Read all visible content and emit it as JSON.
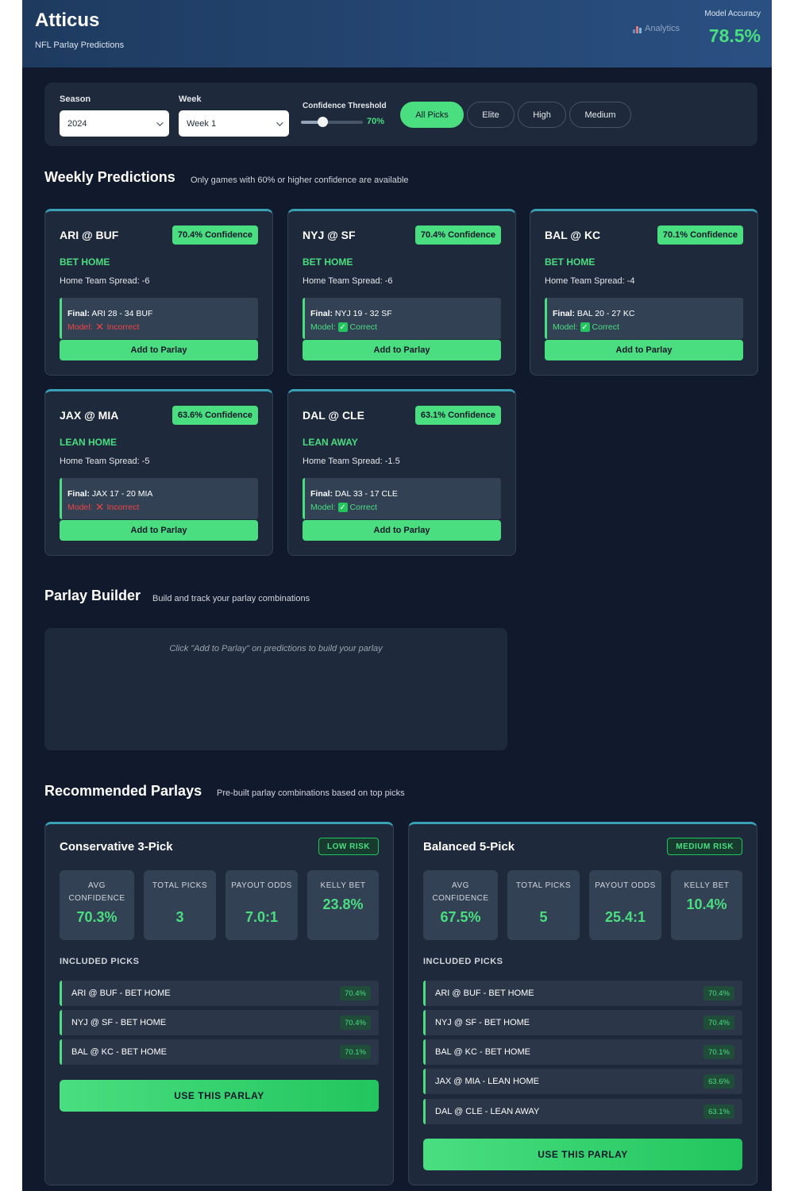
{
  "header": {
    "title": "Atticus",
    "subtitle": "NFL Parlay Predictions",
    "analytics_link": "Analytics",
    "analytics_icon": "bar-chart-icon",
    "accuracy_label": "Model Accuracy",
    "accuracy_value": "78.5%"
  },
  "filters": {
    "season_label": "Season",
    "season_value": "2024",
    "week_label": "Week",
    "week_value": "Week 1",
    "threshold_label": "Confidence Threshold",
    "threshold_value": "70%",
    "threshold_fraction": 0.35,
    "tabs": [
      "All Picks",
      "Elite",
      "High",
      "Medium"
    ],
    "active_tab": "All Picks"
  },
  "weekly": {
    "title": "Weekly Predictions",
    "subtitle": "Only games with 60% or higher confidence are available",
    "add_label": "Add to Parlay",
    "final_label": "Final:",
    "model_label": "Model:",
    "cards": [
      {
        "matchup": "ARI @ BUF",
        "confidence": "70.4% Confidence",
        "bet": "BET HOME",
        "spread": "Home Team Spread: -6",
        "final": "ARI 28 - 34 BUF",
        "model_result": "Incorrect",
        "correct": false
      },
      {
        "matchup": "NYJ @ SF",
        "confidence": "70.4% Confidence",
        "bet": "BET HOME",
        "spread": "Home Team Spread: -6",
        "final": "NYJ 19 - 32 SF",
        "model_result": "Correct",
        "correct": true
      },
      {
        "matchup": "BAL @ KC",
        "confidence": "70.1% Confidence",
        "bet": "BET HOME",
        "spread": "Home Team Spread: -4",
        "final": "BAL 20 - 27 KC",
        "model_result": "Correct",
        "correct": true
      },
      {
        "matchup": "JAX @ MIA",
        "confidence": "63.6% Confidence",
        "bet": "LEAN HOME",
        "spread": "Home Team Spread: -5",
        "final": "JAX 17 - 20 MIA",
        "model_result": "Incorrect",
        "correct": false
      },
      {
        "matchup": "DAL @ CLE",
        "confidence": "63.1% Confidence",
        "bet": "LEAN AWAY",
        "spread": "Home Team Spread: -1.5",
        "final": "DAL 33 - 17 CLE",
        "model_result": "Correct",
        "correct": true
      }
    ]
  },
  "builder": {
    "title": "Parlay Builder",
    "subtitle": "Build and track your parlay combinations",
    "empty_text": "Click \"Add to Parlay\" on predictions to build your parlay"
  },
  "recommended": {
    "title": "Recommended Parlays",
    "subtitle": "Pre-built parlay combinations based on top picks",
    "stat_labels": [
      "AVG CONFIDENCE",
      "TOTAL PICKS",
      "PAYOUT ODDS",
      "KELLY BET"
    ],
    "included_label": "INCLUDED PICKS",
    "use_label": "USE THIS PARLAY",
    "parlays": [
      {
        "title": "Conservative 3-Pick",
        "risk": "LOW RISK",
        "stats": [
          "70.3%",
          "3",
          "7.0:1",
          "23.8%"
        ],
        "picks": [
          {
            "label": "ARI @ BUF - BET HOME",
            "confidence": "70.4%"
          },
          {
            "label": "NYJ @ SF - BET HOME",
            "confidence": "70.4%"
          },
          {
            "label": "BAL @ KC - BET HOME",
            "confidence": "70.1%"
          }
        ]
      },
      {
        "title": "Balanced 5-Pick",
        "risk": "MEDIUM RISK",
        "stats": [
          "67.5%",
          "5",
          "25.4:1",
          "10.4%"
        ],
        "picks": [
          {
            "label": "ARI @ BUF - BET HOME",
            "confidence": "70.4%"
          },
          {
            "label": "NYJ @ SF - BET HOME",
            "confidence": "70.4%"
          },
          {
            "label": "BAL @ KC - BET HOME",
            "confidence": "70.1%"
          },
          {
            "label": "JAX @ MIA - LEAN HOME",
            "confidence": "63.6%"
          },
          {
            "label": "DAL @ CLE - LEAN AWAY",
            "confidence": "63.1%"
          }
        ]
      }
    ]
  }
}
